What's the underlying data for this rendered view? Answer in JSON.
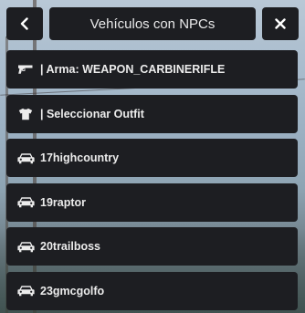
{
  "header": {
    "title": "Vehículos con NPCs",
    "back_icon": "chevron-left-icon",
    "close_icon": "close-icon"
  },
  "menu": {
    "items": [
      {
        "icon": "pistol-icon",
        "label": "| Arma: WEAPON_CARBINERIFLE"
      },
      {
        "icon": "shirt-icon",
        "label": "| Seleccionar Outfit"
      },
      {
        "icon": "car-icon",
        "label": "17highcountry"
      },
      {
        "icon": "car-icon",
        "label": "19raptor"
      },
      {
        "icon": "car-icon",
        "label": "20trailboss"
      },
      {
        "icon": "car-icon",
        "label": "23gmcgolfo"
      }
    ]
  },
  "colors": {
    "panel_bg": "#1d1e22",
    "text": "#ececec"
  }
}
